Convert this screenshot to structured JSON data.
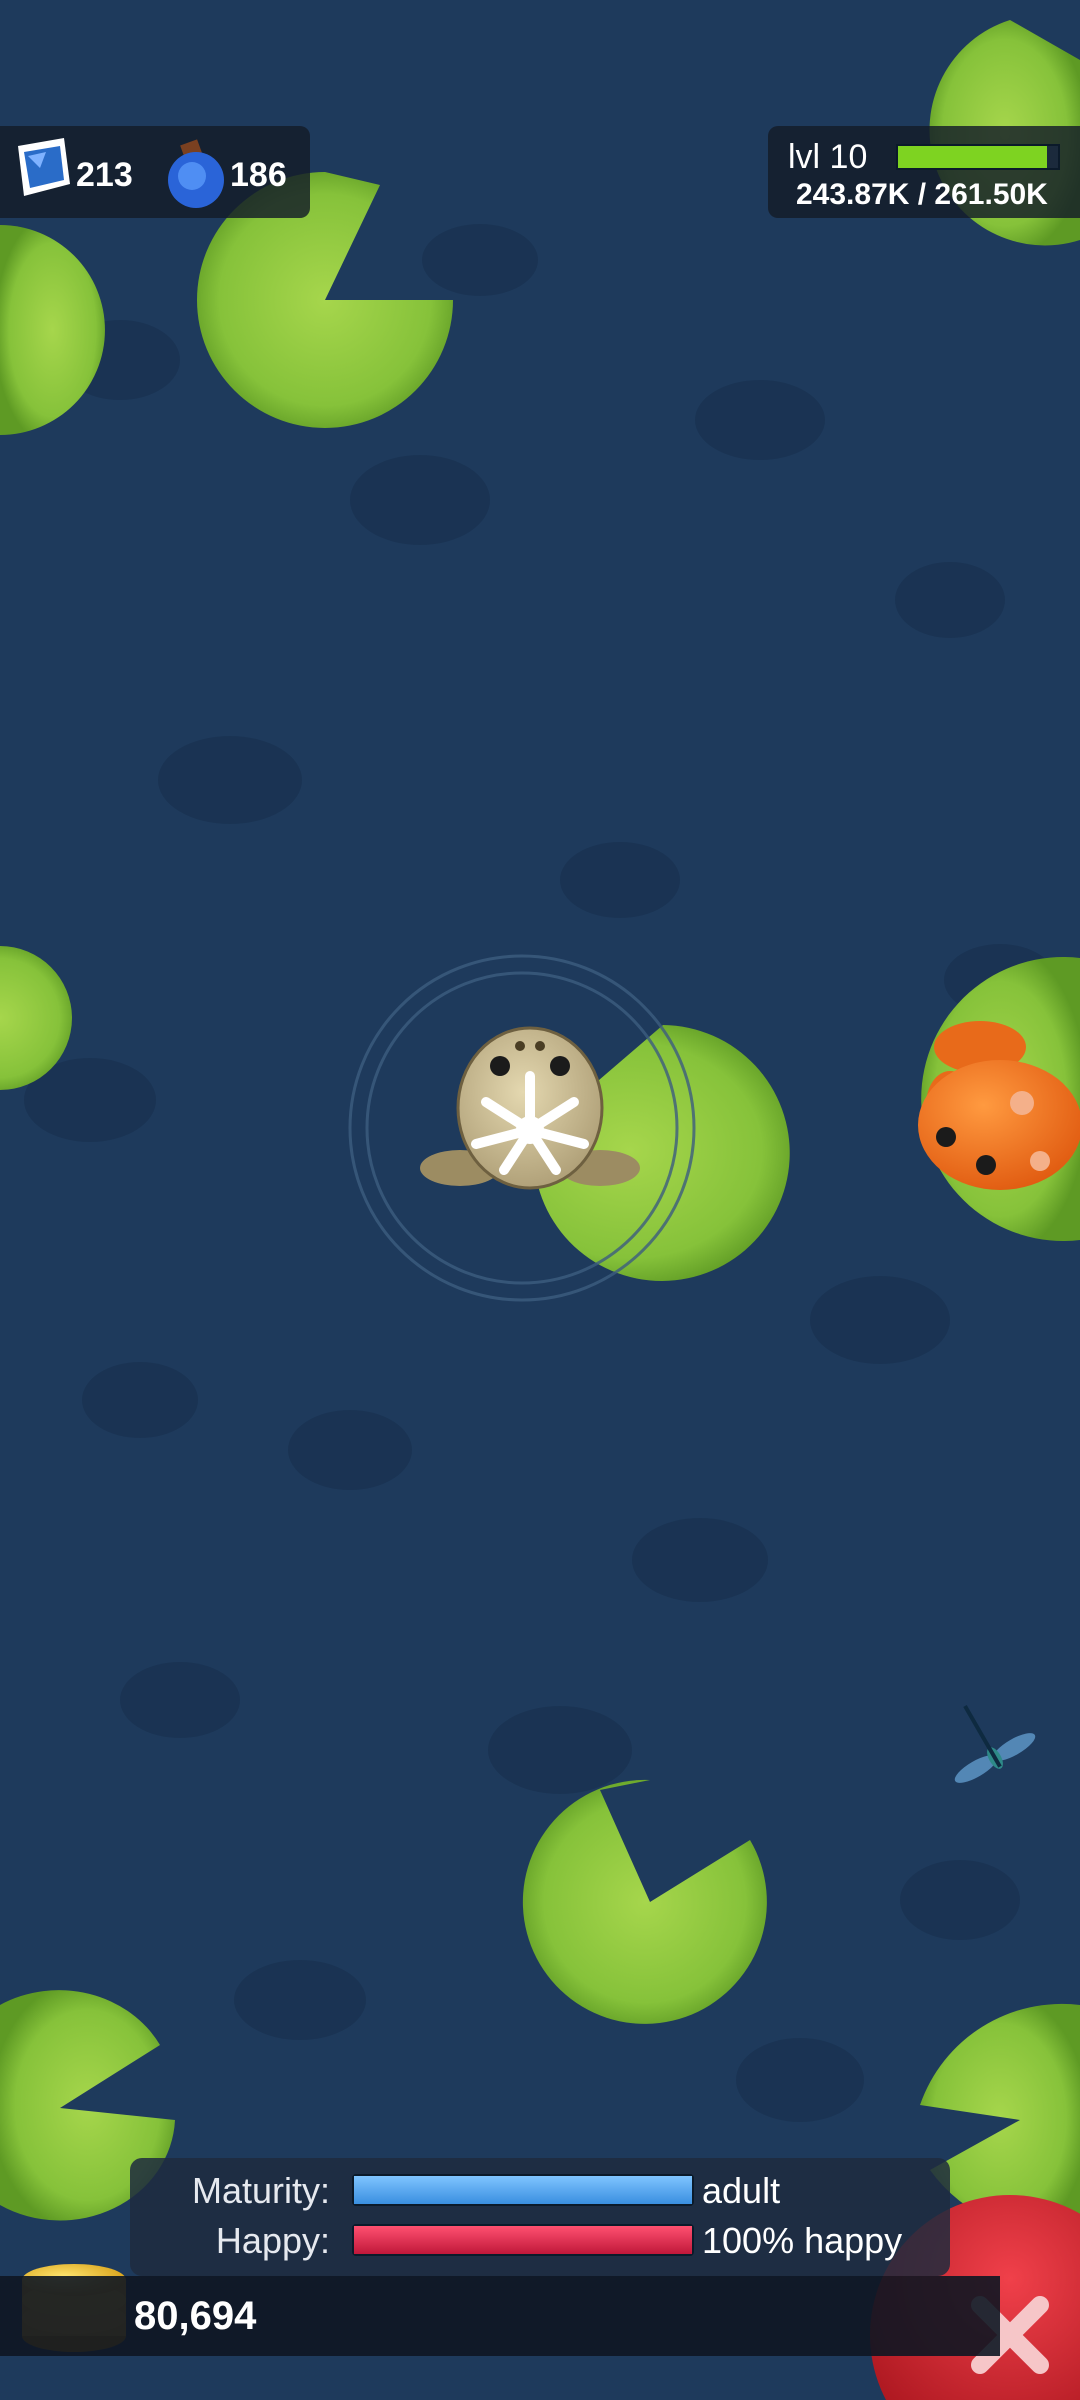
{
  "hud": {
    "gems": "213",
    "potions": "186",
    "level_label": "lvl 10",
    "xp_text": "243.87K / 261.50K",
    "xp_fraction": 0.933
  },
  "stats": {
    "maturity_label": "Maturity:",
    "maturity_value": "adult",
    "maturity_fraction": 1.0,
    "happy_label": "Happy:",
    "happy_value": "100% happy",
    "happy_fraction": 1.0
  },
  "coins": "80,694",
  "colors": {
    "water": "#1e3a5c",
    "lily_pad": "#8cc63f",
    "xp_bar": "#7ed321",
    "maturity_bar": "#4aa8ee",
    "happy_bar": "#e0284a",
    "close_button": "#c8202a",
    "frog_orange": "#f07020"
  },
  "icons": {
    "gem": "blue-gem-icon",
    "potion": "potion-icon",
    "coins": "gold-coin-stack-icon",
    "close": "close-x-icon"
  }
}
